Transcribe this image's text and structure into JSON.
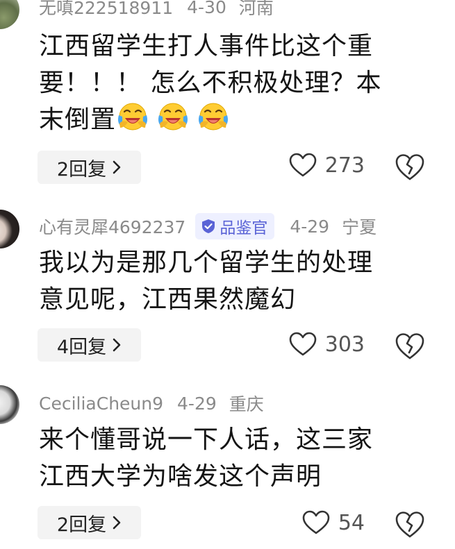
{
  "comments": [
    {
      "user": "无嗔222518911",
      "date": "4-30",
      "location": "河南",
      "text_line1": "江西留学生打人事件比这个重",
      "text_line2": "要！！！ 怎么不积极处理？本",
      "text_line3": "末倒置",
      "emoji_count": 3,
      "emoji": "crying-laughing-emoji",
      "replies": "2回复",
      "likes": "273"
    },
    {
      "user": "心有灵犀4692237",
      "badge": "品鉴官",
      "date": "4-29",
      "location": "宁夏",
      "text_line1": "我以为是那几个留学生的处理",
      "text_line2": "意见呢，江西果然魔幻",
      "replies": "4回复",
      "likes": "303"
    },
    {
      "user": "CeciliaCheun9",
      "date": "4-29",
      "location": "重庆",
      "text_line1": "来个懂哥说一下人话，这三家",
      "text_line2": "江西大学为啥发这个声明",
      "replies": "2回复",
      "likes": "54"
    }
  ],
  "icons": {
    "like": "heart-icon",
    "dislike": "broken-heart-icon",
    "badge": "verified-shield-icon",
    "reply_arrow": "chevron-right-icon"
  },
  "colors": {
    "meta_text": "#8a8a8a",
    "badge_bg": "#eef0ff",
    "badge_text": "#5a63d6",
    "pill_bg": "#f3f3f3"
  }
}
